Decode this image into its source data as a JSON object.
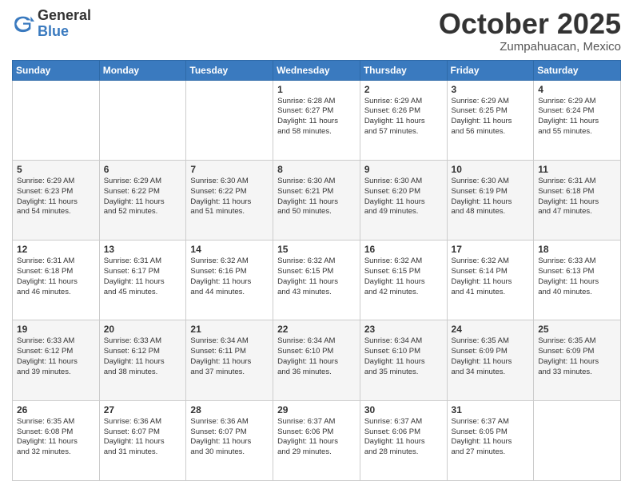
{
  "header": {
    "logo_general": "General",
    "logo_blue": "Blue",
    "month_title": "October 2025",
    "location": "Zumpahuacan, Mexico"
  },
  "weekdays": [
    "Sunday",
    "Monday",
    "Tuesday",
    "Wednesday",
    "Thursday",
    "Friday",
    "Saturday"
  ],
  "weeks": [
    [
      {
        "day": "",
        "info": ""
      },
      {
        "day": "",
        "info": ""
      },
      {
        "day": "",
        "info": ""
      },
      {
        "day": "1",
        "info": "Sunrise: 6:28 AM\nSunset: 6:27 PM\nDaylight: 11 hours\nand 58 minutes."
      },
      {
        "day": "2",
        "info": "Sunrise: 6:29 AM\nSunset: 6:26 PM\nDaylight: 11 hours\nand 57 minutes."
      },
      {
        "day": "3",
        "info": "Sunrise: 6:29 AM\nSunset: 6:25 PM\nDaylight: 11 hours\nand 56 minutes."
      },
      {
        "day": "4",
        "info": "Sunrise: 6:29 AM\nSunset: 6:24 PM\nDaylight: 11 hours\nand 55 minutes."
      }
    ],
    [
      {
        "day": "5",
        "info": "Sunrise: 6:29 AM\nSunset: 6:23 PM\nDaylight: 11 hours\nand 54 minutes."
      },
      {
        "day": "6",
        "info": "Sunrise: 6:29 AM\nSunset: 6:22 PM\nDaylight: 11 hours\nand 52 minutes."
      },
      {
        "day": "7",
        "info": "Sunrise: 6:30 AM\nSunset: 6:22 PM\nDaylight: 11 hours\nand 51 minutes."
      },
      {
        "day": "8",
        "info": "Sunrise: 6:30 AM\nSunset: 6:21 PM\nDaylight: 11 hours\nand 50 minutes."
      },
      {
        "day": "9",
        "info": "Sunrise: 6:30 AM\nSunset: 6:20 PM\nDaylight: 11 hours\nand 49 minutes."
      },
      {
        "day": "10",
        "info": "Sunrise: 6:30 AM\nSunset: 6:19 PM\nDaylight: 11 hours\nand 48 minutes."
      },
      {
        "day": "11",
        "info": "Sunrise: 6:31 AM\nSunset: 6:18 PM\nDaylight: 11 hours\nand 47 minutes."
      }
    ],
    [
      {
        "day": "12",
        "info": "Sunrise: 6:31 AM\nSunset: 6:18 PM\nDaylight: 11 hours\nand 46 minutes."
      },
      {
        "day": "13",
        "info": "Sunrise: 6:31 AM\nSunset: 6:17 PM\nDaylight: 11 hours\nand 45 minutes."
      },
      {
        "day": "14",
        "info": "Sunrise: 6:32 AM\nSunset: 6:16 PM\nDaylight: 11 hours\nand 44 minutes."
      },
      {
        "day": "15",
        "info": "Sunrise: 6:32 AM\nSunset: 6:15 PM\nDaylight: 11 hours\nand 43 minutes."
      },
      {
        "day": "16",
        "info": "Sunrise: 6:32 AM\nSunset: 6:15 PM\nDaylight: 11 hours\nand 42 minutes."
      },
      {
        "day": "17",
        "info": "Sunrise: 6:32 AM\nSunset: 6:14 PM\nDaylight: 11 hours\nand 41 minutes."
      },
      {
        "day": "18",
        "info": "Sunrise: 6:33 AM\nSunset: 6:13 PM\nDaylight: 11 hours\nand 40 minutes."
      }
    ],
    [
      {
        "day": "19",
        "info": "Sunrise: 6:33 AM\nSunset: 6:12 PM\nDaylight: 11 hours\nand 39 minutes."
      },
      {
        "day": "20",
        "info": "Sunrise: 6:33 AM\nSunset: 6:12 PM\nDaylight: 11 hours\nand 38 minutes."
      },
      {
        "day": "21",
        "info": "Sunrise: 6:34 AM\nSunset: 6:11 PM\nDaylight: 11 hours\nand 37 minutes."
      },
      {
        "day": "22",
        "info": "Sunrise: 6:34 AM\nSunset: 6:10 PM\nDaylight: 11 hours\nand 36 minutes."
      },
      {
        "day": "23",
        "info": "Sunrise: 6:34 AM\nSunset: 6:10 PM\nDaylight: 11 hours\nand 35 minutes."
      },
      {
        "day": "24",
        "info": "Sunrise: 6:35 AM\nSunset: 6:09 PM\nDaylight: 11 hours\nand 34 minutes."
      },
      {
        "day": "25",
        "info": "Sunrise: 6:35 AM\nSunset: 6:09 PM\nDaylight: 11 hours\nand 33 minutes."
      }
    ],
    [
      {
        "day": "26",
        "info": "Sunrise: 6:35 AM\nSunset: 6:08 PM\nDaylight: 11 hours\nand 32 minutes."
      },
      {
        "day": "27",
        "info": "Sunrise: 6:36 AM\nSunset: 6:07 PM\nDaylight: 11 hours\nand 31 minutes."
      },
      {
        "day": "28",
        "info": "Sunrise: 6:36 AM\nSunset: 6:07 PM\nDaylight: 11 hours\nand 30 minutes."
      },
      {
        "day": "29",
        "info": "Sunrise: 6:37 AM\nSunset: 6:06 PM\nDaylight: 11 hours\nand 29 minutes."
      },
      {
        "day": "30",
        "info": "Sunrise: 6:37 AM\nSunset: 6:06 PM\nDaylight: 11 hours\nand 28 minutes."
      },
      {
        "day": "31",
        "info": "Sunrise: 6:37 AM\nSunset: 6:05 PM\nDaylight: 11 hours\nand 27 minutes."
      },
      {
        "day": "",
        "info": ""
      }
    ]
  ]
}
